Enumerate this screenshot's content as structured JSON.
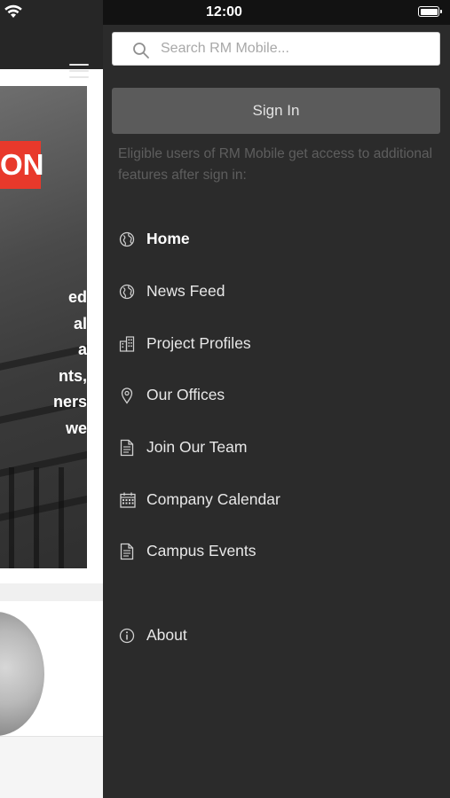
{
  "status_bar": {
    "time": "12:00"
  },
  "background_page": {
    "hero_badge": "ON",
    "hero_text_lines": [
      "ed",
      "al",
      "a",
      "nts,",
      "ners",
      "we"
    ]
  },
  "drawer": {
    "search": {
      "placeholder": "Search RM Mobile..."
    },
    "sign_in_label": "Sign In",
    "sign_in_note": "Eligible users of RM Mobile get access to additional features after sign in:",
    "menu": [
      {
        "label": "Home",
        "icon": "globe-icon",
        "active": true
      },
      {
        "label": "News Feed",
        "icon": "globe-icon",
        "active": false
      },
      {
        "label": "Project Profiles",
        "icon": "building-icon",
        "active": false
      },
      {
        "label": "Our Offices",
        "icon": "location-pin-icon",
        "active": false
      },
      {
        "label": "Join Our Team",
        "icon": "document-icon",
        "active": false
      },
      {
        "label": "Company Calendar",
        "icon": "calendar-icon",
        "active": false
      },
      {
        "label": "Campus Events",
        "icon": "document-icon",
        "active": false
      },
      {
        "label": "About",
        "icon": "info-icon",
        "active": false
      }
    ]
  },
  "colors": {
    "drawer_background": "#2b2b2b",
    "sign_in_button": "#5b5b5b",
    "accent_red": "#e8392b"
  }
}
